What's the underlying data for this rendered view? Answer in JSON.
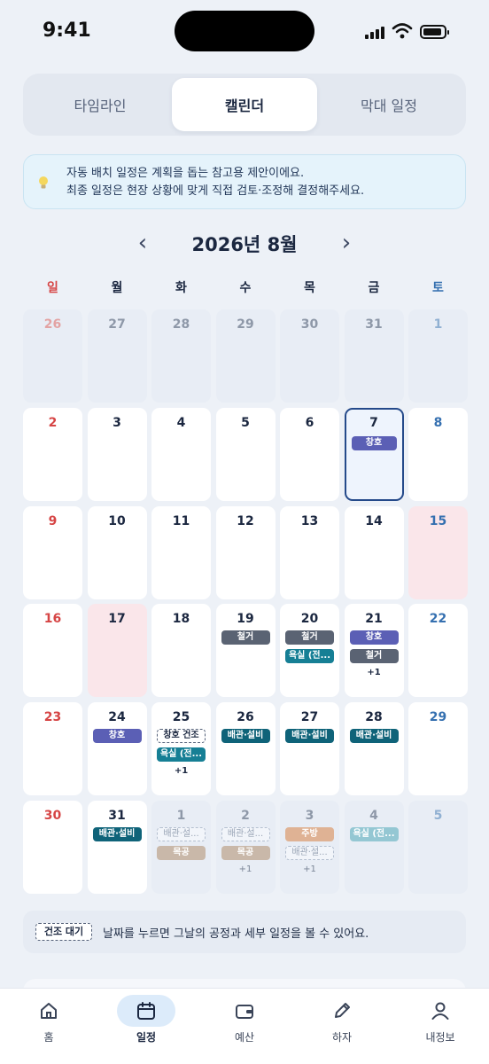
{
  "status_bar": {
    "time": "9:41"
  },
  "view_tabs": [
    {
      "label": "타임라인",
      "active": false
    },
    {
      "label": "캘린더",
      "active": true
    },
    {
      "label": "막대 일정",
      "active": false
    }
  ],
  "notice": {
    "icon": "lightbulb-icon",
    "line1": "자동 배치 일정은 계획을 돕는 참고용 제안이에요.",
    "line2": "최종 일정은 현장 상황에 맞게 직접 검토·조정해 결정해주세요."
  },
  "calendar": {
    "title": "2026년 8월",
    "prev_icon": "‹",
    "next_icon": "›",
    "weekdays": [
      "일",
      "월",
      "화",
      "수",
      "목",
      "금",
      "토"
    ],
    "weeks": [
      [
        {
          "day": "26",
          "muted": true,
          "chips": []
        },
        {
          "day": "27",
          "muted": true,
          "chips": []
        },
        {
          "day": "28",
          "muted": true,
          "chips": []
        },
        {
          "day": "29",
          "muted": true,
          "chips": []
        },
        {
          "day": "30",
          "muted": true,
          "chips": []
        },
        {
          "day": "31",
          "muted": true,
          "chips": []
        },
        {
          "day": "1",
          "muted": true,
          "chips": []
        }
      ],
      [
        {
          "day": "2",
          "chips": []
        },
        {
          "day": "3",
          "chips": []
        },
        {
          "day": "4",
          "chips": []
        },
        {
          "day": "5",
          "chips": []
        },
        {
          "day": "6",
          "chips": []
        },
        {
          "day": "7",
          "selected": true,
          "chips": [
            {
              "label": "창호",
              "style": "purple"
            }
          ]
        },
        {
          "day": "8",
          "chips": []
        }
      ],
      [
        {
          "day": "9",
          "chips": []
        },
        {
          "day": "10",
          "chips": []
        },
        {
          "day": "11",
          "chips": []
        },
        {
          "day": "12",
          "chips": []
        },
        {
          "day": "13",
          "chips": []
        },
        {
          "day": "14",
          "chips": []
        },
        {
          "day": "15",
          "holiday": true,
          "chips": []
        }
      ],
      [
        {
          "day": "16",
          "chips": []
        },
        {
          "day": "17",
          "holiday": true,
          "chips": []
        },
        {
          "day": "18",
          "chips": []
        },
        {
          "day": "19",
          "chips": [
            {
              "label": "철거",
              "style": "gray"
            }
          ]
        },
        {
          "day": "20",
          "chips": [
            {
              "label": "철거",
              "style": "gray"
            },
            {
              "label": "욕실 (전...",
              "style": "teal"
            }
          ]
        },
        {
          "day": "21",
          "chips": [
            {
              "label": "창호",
              "style": "purple"
            },
            {
              "label": "철거",
              "style": "gray"
            }
          ],
          "more": "+1"
        },
        {
          "day": "22",
          "chips": []
        }
      ],
      [
        {
          "day": "23",
          "chips": []
        },
        {
          "day": "24",
          "chips": [
            {
              "label": "창호",
              "style": "purple"
            }
          ]
        },
        {
          "day": "25",
          "chips": [
            {
              "label": "창호 건조",
              "style": "dashed"
            },
            {
              "label": "욕실 (전...",
              "style": "teal"
            }
          ],
          "more": "+1"
        },
        {
          "day": "26",
          "chips": [
            {
              "label": "배관·설비",
              "style": "navy"
            }
          ]
        },
        {
          "day": "27",
          "chips": [
            {
              "label": "배관·설비",
              "style": "navy"
            }
          ]
        },
        {
          "day": "28",
          "chips": [
            {
              "label": "배관·설비",
              "style": "navy"
            }
          ]
        },
        {
          "day": "29",
          "chips": []
        }
      ],
      [
        {
          "day": "30",
          "chips": []
        },
        {
          "day": "31",
          "chips": [
            {
              "label": "배관·설비",
              "style": "navy"
            }
          ]
        },
        {
          "day": "1",
          "muted": true,
          "chips": [
            {
              "label": "배관·설...",
              "style": "f-dashed"
            },
            {
              "label": "목공",
              "style": "f-tan"
            }
          ]
        },
        {
          "day": "2",
          "muted": true,
          "chips": [
            {
              "label": "배관·설...",
              "style": "f-dashed"
            },
            {
              "label": "목공",
              "style": "f-tan"
            }
          ],
          "more": "+1"
        },
        {
          "day": "3",
          "muted": true,
          "chips": [
            {
              "label": "주방",
              "style": "f-peach"
            },
            {
              "label": "배관·설...",
              "style": "f-dashed"
            }
          ],
          "more": "+1"
        },
        {
          "day": "4",
          "muted": true,
          "chips": [
            {
              "label": "욕실 (전...",
              "style": "f-teal"
            }
          ]
        },
        {
          "day": "5",
          "muted": true,
          "chips": []
        }
      ]
    ]
  },
  "legend": {
    "chip_label": "건조 대기",
    "text": "날짜를 누르면 그날의 공정과 세부 일정을 볼 수 있어요."
  },
  "tabbar": [
    {
      "label": "홈",
      "icon": "home-icon",
      "active": false
    },
    {
      "label": "일정",
      "icon": "calendar-icon",
      "active": true
    },
    {
      "label": "예산",
      "icon": "wallet-icon",
      "active": false
    },
    {
      "label": "하자",
      "icon": "pencil-icon",
      "active": false
    },
    {
      "label": "내정보",
      "icon": "person-icon",
      "active": false
    }
  ],
  "colors": {
    "primary": "#1b2740",
    "selected_border": "#254a8a",
    "chip_window": "#5b5fb5",
    "chip_demolition": "#5a6373",
    "chip_bath": "#167f95",
    "chip_plumbing": "#0f6379",
    "sunday": "#d64545",
    "saturday": "#3570b0"
  }
}
